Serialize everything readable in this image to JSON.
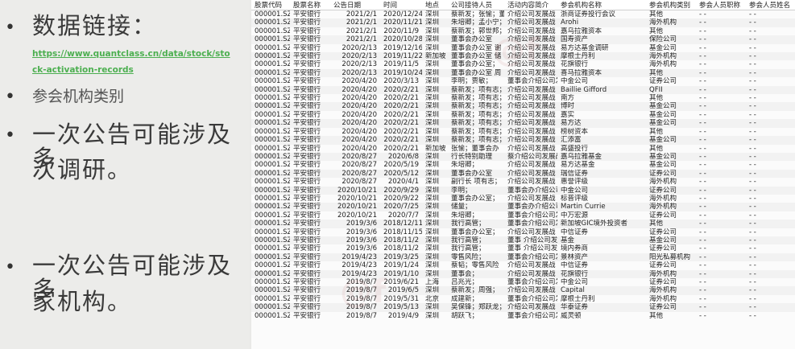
{
  "slide": {
    "line1": "数据链接：",
    "link": "https://www.quantclass.cn/data/stock/stock-activation-records",
    "category": "参会机构类别",
    "point1_a": "一次公告可能涉及多",
    "point1_b": "次调研。",
    "point2_a": "一次公告可能涉及多",
    "point2_b": "家机构。"
  },
  "table": {
    "headers": [
      "股票代码",
      "股票名称",
      "公告日期",
      "时间",
      "地点",
      "公司接待人员",
      "活动内容简介",
      "参会机构名称",
      "参会机构类别",
      "参会人员职称",
      "参会人员姓名"
    ],
    "rows": [
      [
        "000001.SZ",
        "平安银行",
        "2021/2/1",
        "2020/12/24",
        "深圳",
        "蔡新发；张愉；董",
        "介绍公司发展战",
        "浙商证券投行会议",
        "其他",
        "- -",
        "- -"
      ],
      [
        "000001.SZ",
        "平安银行",
        "2021/2/1",
        "2020/11/21",
        "深圳",
        "朱培卿；孟小宁；",
        "介绍公司发展战",
        "Arohi",
        "海外机构",
        "- -",
        "- -"
      ],
      [
        "000001.SZ",
        "平安银行",
        "2021/2/1",
        "2020/11/9",
        "深圳",
        "蔡新发；郭世邦；",
        "介绍公司发展战",
        "嘉乌拉雅资本",
        "其他",
        "- -",
        "- -"
      ],
      [
        "000001.SZ",
        "平安银行",
        "2021/2/1",
        "2020/10/28",
        "深圳",
        "董事会办公室",
        "介绍公司发展战",
        "国寿资产",
        "保险公司",
        "- -",
        "- -"
      ],
      [
        "000001.SZ",
        "平安银行",
        "2020/2/13",
        "2019/12/16",
        "深圳",
        "董事会办公室 谢",
        "介绍公司发展战",
        "易方达基金调研",
        "基金公司",
        "- -",
        "- -"
      ],
      [
        "000001.SZ",
        "平安银行",
        "2020/2/13",
        "2019/11/22",
        "新加坡",
        "董事会办公室 储",
        "介绍公司发展战",
        "摩根士丹利",
        "海外机构",
        "- -",
        "- -"
      ],
      [
        "000001.SZ",
        "平安银行",
        "2020/2/13",
        "2019/11/5",
        "深圳",
        "董事会办公室；",
        "介绍公司发展战",
        "花旗银行",
        "海外机构",
        "- -",
        "- -"
      ],
      [
        "000001.SZ",
        "平安银行",
        "2020/2/13",
        "2019/10/24",
        "深圳",
        "董事会办公室 周",
        "介绍公司发展战",
        "喜马拉雅资本",
        "其他",
        "- -",
        "- -"
      ],
      [
        "000001.SZ",
        "平安银行",
        "2020/4/20",
        "2020/3/13",
        "深圳",
        "李明；贾敏；",
        "董事会介绍公司发展战",
        "中金公司",
        "证券公司",
        "- -",
        "- -"
      ],
      [
        "000001.SZ",
        "平安银行",
        "2020/4/20",
        "2020/2/21",
        "深圳",
        "蔡新发；项有志；",
        "介绍公司发展战",
        "Baillie Gifford",
        "QFII",
        "- -",
        "- -"
      ],
      [
        "000001.SZ",
        "平安银行",
        "2020/4/20",
        "2020/2/21",
        "深圳",
        "蔡新发；项有志；",
        "介绍公司发展战",
        "南方",
        "其他",
        "- -",
        "- -"
      ],
      [
        "000001.SZ",
        "平安银行",
        "2020/4/20",
        "2020/2/21",
        "深圳",
        "蔡新发；项有志；",
        "介绍公司发展战",
        "博时",
        "基金公司",
        "- -",
        "- -"
      ],
      [
        "000001.SZ",
        "平安银行",
        "2020/4/20",
        "2020/2/21",
        "深圳",
        "蔡新发；项有志；",
        "介绍公司发展战",
        "嘉实",
        "基金公司",
        "- -",
        "- -"
      ],
      [
        "000001.SZ",
        "平安银行",
        "2020/4/20",
        "2020/2/21",
        "深圳",
        "蔡新发；项有志；",
        "介绍公司发展战",
        "易方达",
        "基金公司",
        "- -",
        "- -"
      ],
      [
        "000001.SZ",
        "平安银行",
        "2020/4/20",
        "2020/2/21",
        "深圳",
        "蔡新发；项有志；",
        "介绍公司发展战",
        "榜树资本",
        "其他",
        "- -",
        "- -"
      ],
      [
        "000001.SZ",
        "平安银行",
        "2020/4/20",
        "2020/2/21",
        "深圳",
        "蔡新发；项有志；",
        "介绍公司发展战",
        "汇添富",
        "基金公司",
        "- -",
        "- -"
      ],
      [
        "000001.SZ",
        "平安银行",
        "2020/4/20",
        "2020/2/21",
        "新加坡",
        "张愉；董事会办",
        "介绍公司发展战",
        "高盛投行",
        "其他",
        "- -",
        "- -"
      ],
      [
        "000001.SZ",
        "平安银行",
        "2020/8/27",
        "2020/6/8",
        "深圳",
        "行长特别助理",
        "蔡介绍公司发展战",
        "嘉乌拉雅基金",
        "基金公司",
        "- -",
        "- -"
      ],
      [
        "000001.SZ",
        "平安银行",
        "2020/8/27",
        "2020/5/19",
        "深圳",
        "朱培卿；",
        "介绍公司发展战",
        "易方达基金",
        "基金公司",
        "- -",
        "- -"
      ],
      [
        "000001.SZ",
        "平安银行",
        "2020/8/27",
        "2020/5/12",
        "深圳",
        "董事会办公室",
        "介绍公司发展战",
        "瑞信证券",
        "证券公司",
        "- -",
        "- -"
      ],
      [
        "000001.SZ",
        "平安银行",
        "2020/8/27",
        "2020/4/1",
        "深圳",
        "副行长 项有志；",
        "介绍公司发展战",
        "惠誉评级",
        "海外机构",
        "- -",
        "- -"
      ],
      [
        "000001.SZ",
        "平安银行",
        "2020/10/21",
        "2020/9/29",
        "深圳",
        "李明；",
        "董事会办介绍公司发展战",
        "中金公司",
        "证券公司",
        "- -",
        "- -"
      ],
      [
        "000001.SZ",
        "平安银行",
        "2020/10/21",
        "2020/9/22",
        "深圳",
        "董事会办公室；",
        "介绍公司发展战",
        "标普评级",
        "海外机构",
        "- -",
        "- -"
      ],
      [
        "000001.SZ",
        "平安银行",
        "2020/10/21",
        "2020/7/25",
        "深圳",
        "储量；",
        "董事会办介绍公司发展战",
        "Martin Currie",
        "海外机构",
        "- -",
        "- -"
      ],
      [
        "000001.SZ",
        "平安银行",
        "2020/10/21",
        "2020/7/7",
        "深圳",
        "朱培卿；",
        "董事会介绍公司发展战",
        "中万宏源",
        "证券公司",
        "- -",
        "- -"
      ],
      [
        "000001.SZ",
        "平安银行",
        "2019/3/6",
        "2018/12/11",
        "深圳",
        "我行高管；",
        "董事会介绍公司发展战",
        "新加坡GIC境外投资者",
        "其他",
        "- -",
        "- -"
      ],
      [
        "000001.SZ",
        "平安银行",
        "2019/3/6",
        "2018/11/15",
        "深圳",
        "董事会办公室；",
        "介绍公司发展战",
        "中信证券",
        "证券公司",
        "- -",
        "- -"
      ],
      [
        "000001.SZ",
        "平安银行",
        "2019/3/6",
        "2018/11/2",
        "深圳",
        "我行高管；",
        "董事 介绍公司发展战",
        "基金",
        "基金公司",
        "- -",
        "- -"
      ],
      [
        "000001.SZ",
        "平安银行",
        "2019/3/6",
        "2018/11/2",
        "深圳",
        "我行高管；",
        "董事 介绍公司发展战",
        "境内券商",
        "证券公司",
        "- -",
        "- -"
      ],
      [
        "000001.SZ",
        "平安银行",
        "2019/4/23",
        "2019/3/25",
        "深圳",
        "零售风险；",
        "董事会介绍公司发展战",
        "景林资产",
        "阳光私募机构",
        "- -",
        "- -"
      ],
      [
        "000001.SZ",
        "平安银行",
        "2019/4/23",
        "2019/1/24",
        "深圳",
        "蔡韬；零售风险",
        "介绍公司发展战",
        "中信证券",
        "证券公司",
        "- -",
        "- -"
      ],
      [
        "000001.SZ",
        "平安银行",
        "2019/4/23",
        "2019/1/10",
        "深圳",
        "董事会；",
        "介绍公司发展战",
        "花旗银行",
        "海外机构",
        "- -",
        "- -"
      ],
      [
        "000001.SZ",
        "平安银行",
        "2019/8/7",
        "2019/6/21",
        "上海",
        "吕兆光；",
        "董事会介绍公司发展战",
        "中金公司",
        "证券公司",
        "- -",
        "- -"
      ],
      [
        "000001.SZ",
        "平安银行",
        "2019/8/7",
        "2019/6/5",
        "深圳",
        "蔡新发；周强；",
        "介绍公司发展战",
        "Capital",
        "海外机构",
        "- -",
        "- -"
      ],
      [
        "000001.SZ",
        "平安银行",
        "2019/8/7",
        "2019/5/31",
        "北京",
        "成建新；",
        "董事会介绍公司发展战",
        "摩根士丹利",
        "海外机构",
        "- -",
        "- -"
      ],
      [
        "000001.SZ",
        "平安银行",
        "2019/8/7",
        "2019/5/13",
        "深圳",
        "吴保锋；郑跃龙；",
        "介绍公司发展战",
        "华泰证券",
        "证券公司",
        "- -",
        "- -"
      ],
      [
        "000001.SZ",
        "平安银行",
        "2019/8/7",
        "2019/4/9",
        "深圳",
        "胡跃飞；",
        "董事会介绍公司发展战",
        "威灵顿",
        "其他",
        "- -",
        "- -"
      ]
    ]
  }
}
